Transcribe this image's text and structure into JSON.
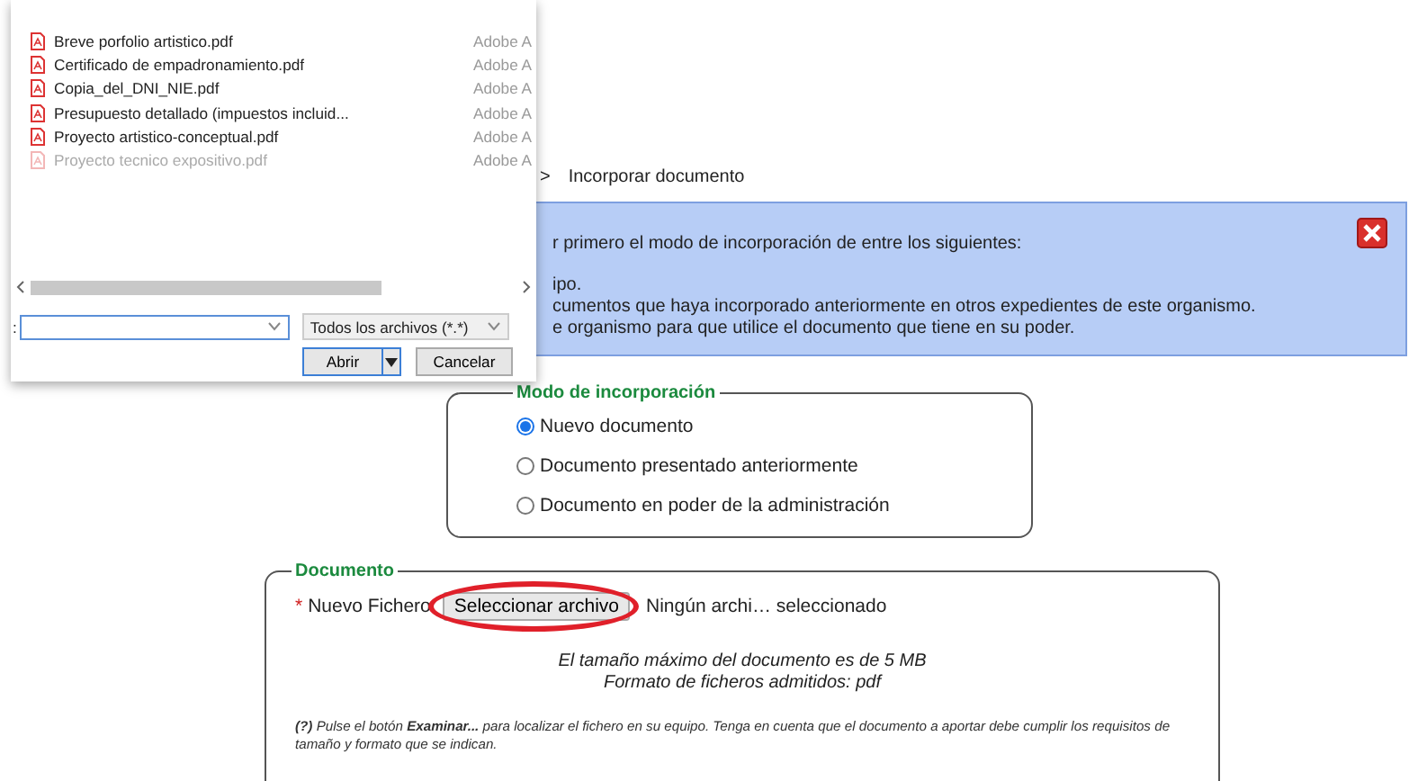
{
  "file_dialog": {
    "files": [
      {
        "name": "Breve porfolio artistico.pdf",
        "type": "Adobe A",
        "dimmed": false
      },
      {
        "name": "Certificado de empadronamiento.pdf",
        "type": "Adobe A",
        "dimmed": false
      },
      {
        "name": "Copia_del_DNI_NIE.pdf",
        "type": "Adobe A",
        "dimmed": false
      },
      {
        "name": "Presupuesto detallado (impuestos incluid...",
        "type": "Adobe A",
        "dimmed": false
      },
      {
        "name": "Proyecto artistico-conceptual.pdf",
        "type": "Adobe A",
        "dimmed": false
      },
      {
        "name": "Proyecto tecnico expositivo.pdf",
        "type": "Adobe A",
        "dimmed": true
      }
    ],
    "filename_label": ":",
    "file_type_filter": "Todos los archivos (*.*)",
    "buttons": [
      {
        "label": "Abrir",
        "kind": "split",
        "default": true
      },
      {
        "label": "Cancelar",
        "kind": "plain",
        "default": false
      }
    ]
  },
  "breadcrumb": {
    "separator": ">",
    "current": "Incorporar documento"
  },
  "info_box": {
    "intro": "r primero el modo de incorporación de entre los siguientes:",
    "items": [
      "ipo.",
      "cumentos que haya incorporado anteriormente en otros expedientes de este organismo.",
      "e organismo para que utilice el documento que tiene en su poder."
    ]
  },
  "mode_fieldset": {
    "legend": "Modo de incorporación",
    "options": [
      {
        "label": "Nuevo documento",
        "selected": true
      },
      {
        "label": "Documento presentado anteriormente",
        "selected": false
      },
      {
        "label": "Documento en poder de la administración",
        "selected": false
      }
    ]
  },
  "document_fieldset": {
    "legend": "Documento",
    "file_field": {
      "required_mark": "*",
      "label": "Nuevo Fichero",
      "button": "Seleccionar archivo",
      "status": "Ningún archi… seleccionado",
      "highlighted": true
    },
    "limits": [
      "El tamaño máximo del documento es de 5 MB",
      "Formato de ficheros admitidos: pdf"
    ],
    "help": "**(?)** Pulse el botón **Examinar...** para localizar el fichero en su equipo. Tenga en cuenta que el documento a aportar debe cumplir los requisitos de tamaño y formato que se indican."
  }
}
